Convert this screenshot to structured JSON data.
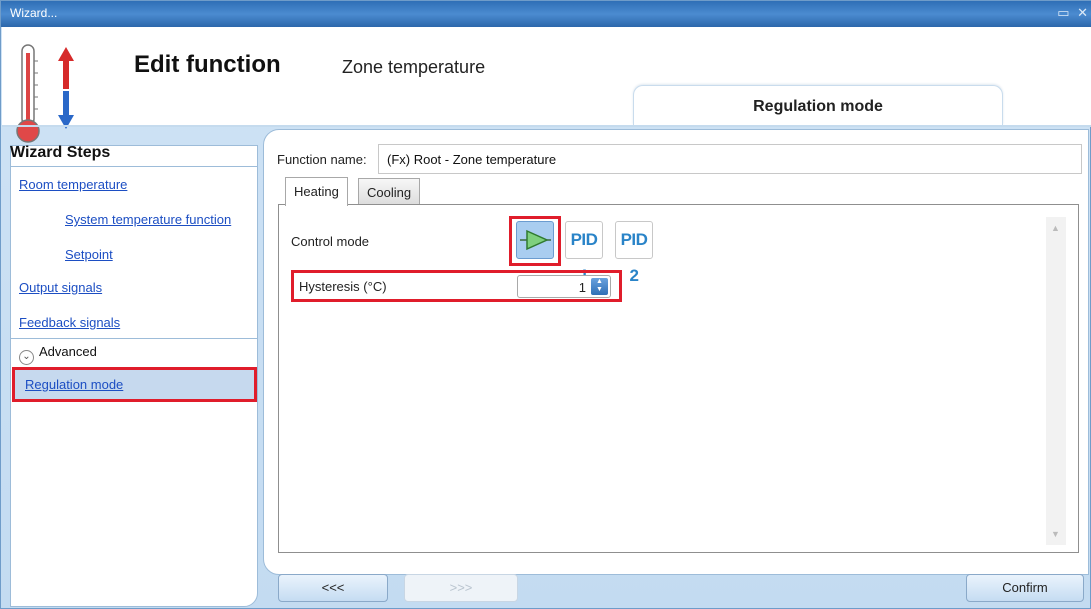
{
  "window": {
    "title": "Wizard..."
  },
  "header": {
    "title": "Edit function",
    "subtitle": "Zone temperature",
    "current_step": "Regulation mode"
  },
  "sidebar": {
    "title": "Wizard Steps",
    "items": [
      {
        "label": "Room temperature"
      },
      {
        "label": "System temperature function"
      },
      {
        "label": "Setpoint"
      },
      {
        "label": "Output signals"
      },
      {
        "label": "Feedback signals"
      }
    ],
    "advanced_label": "Advanced",
    "selected_item": "Regulation mode"
  },
  "form": {
    "function_name_label": "Function name:",
    "function_name_value": "(Fx) Root - Zone temperature",
    "tabs": [
      {
        "label": "Heating"
      },
      {
        "label": "Cooling"
      }
    ],
    "active_tab": "Heating",
    "control_mode_label": "Control mode",
    "control_mode_options": [
      {
        "label": "PID 1"
      },
      {
        "label": "PID 2"
      }
    ],
    "hysteresis_label": "Hysteresis (°C)",
    "hysteresis_value": "1"
  },
  "buttons": {
    "back": "<<<",
    "next": ">>>",
    "confirm": "Confirm"
  },
  "colors": {
    "titlebar": "#2f6fb6",
    "link": "#1c4ec3",
    "highlight": "#e01d2b",
    "selected_bg": "#c6d9ee"
  }
}
